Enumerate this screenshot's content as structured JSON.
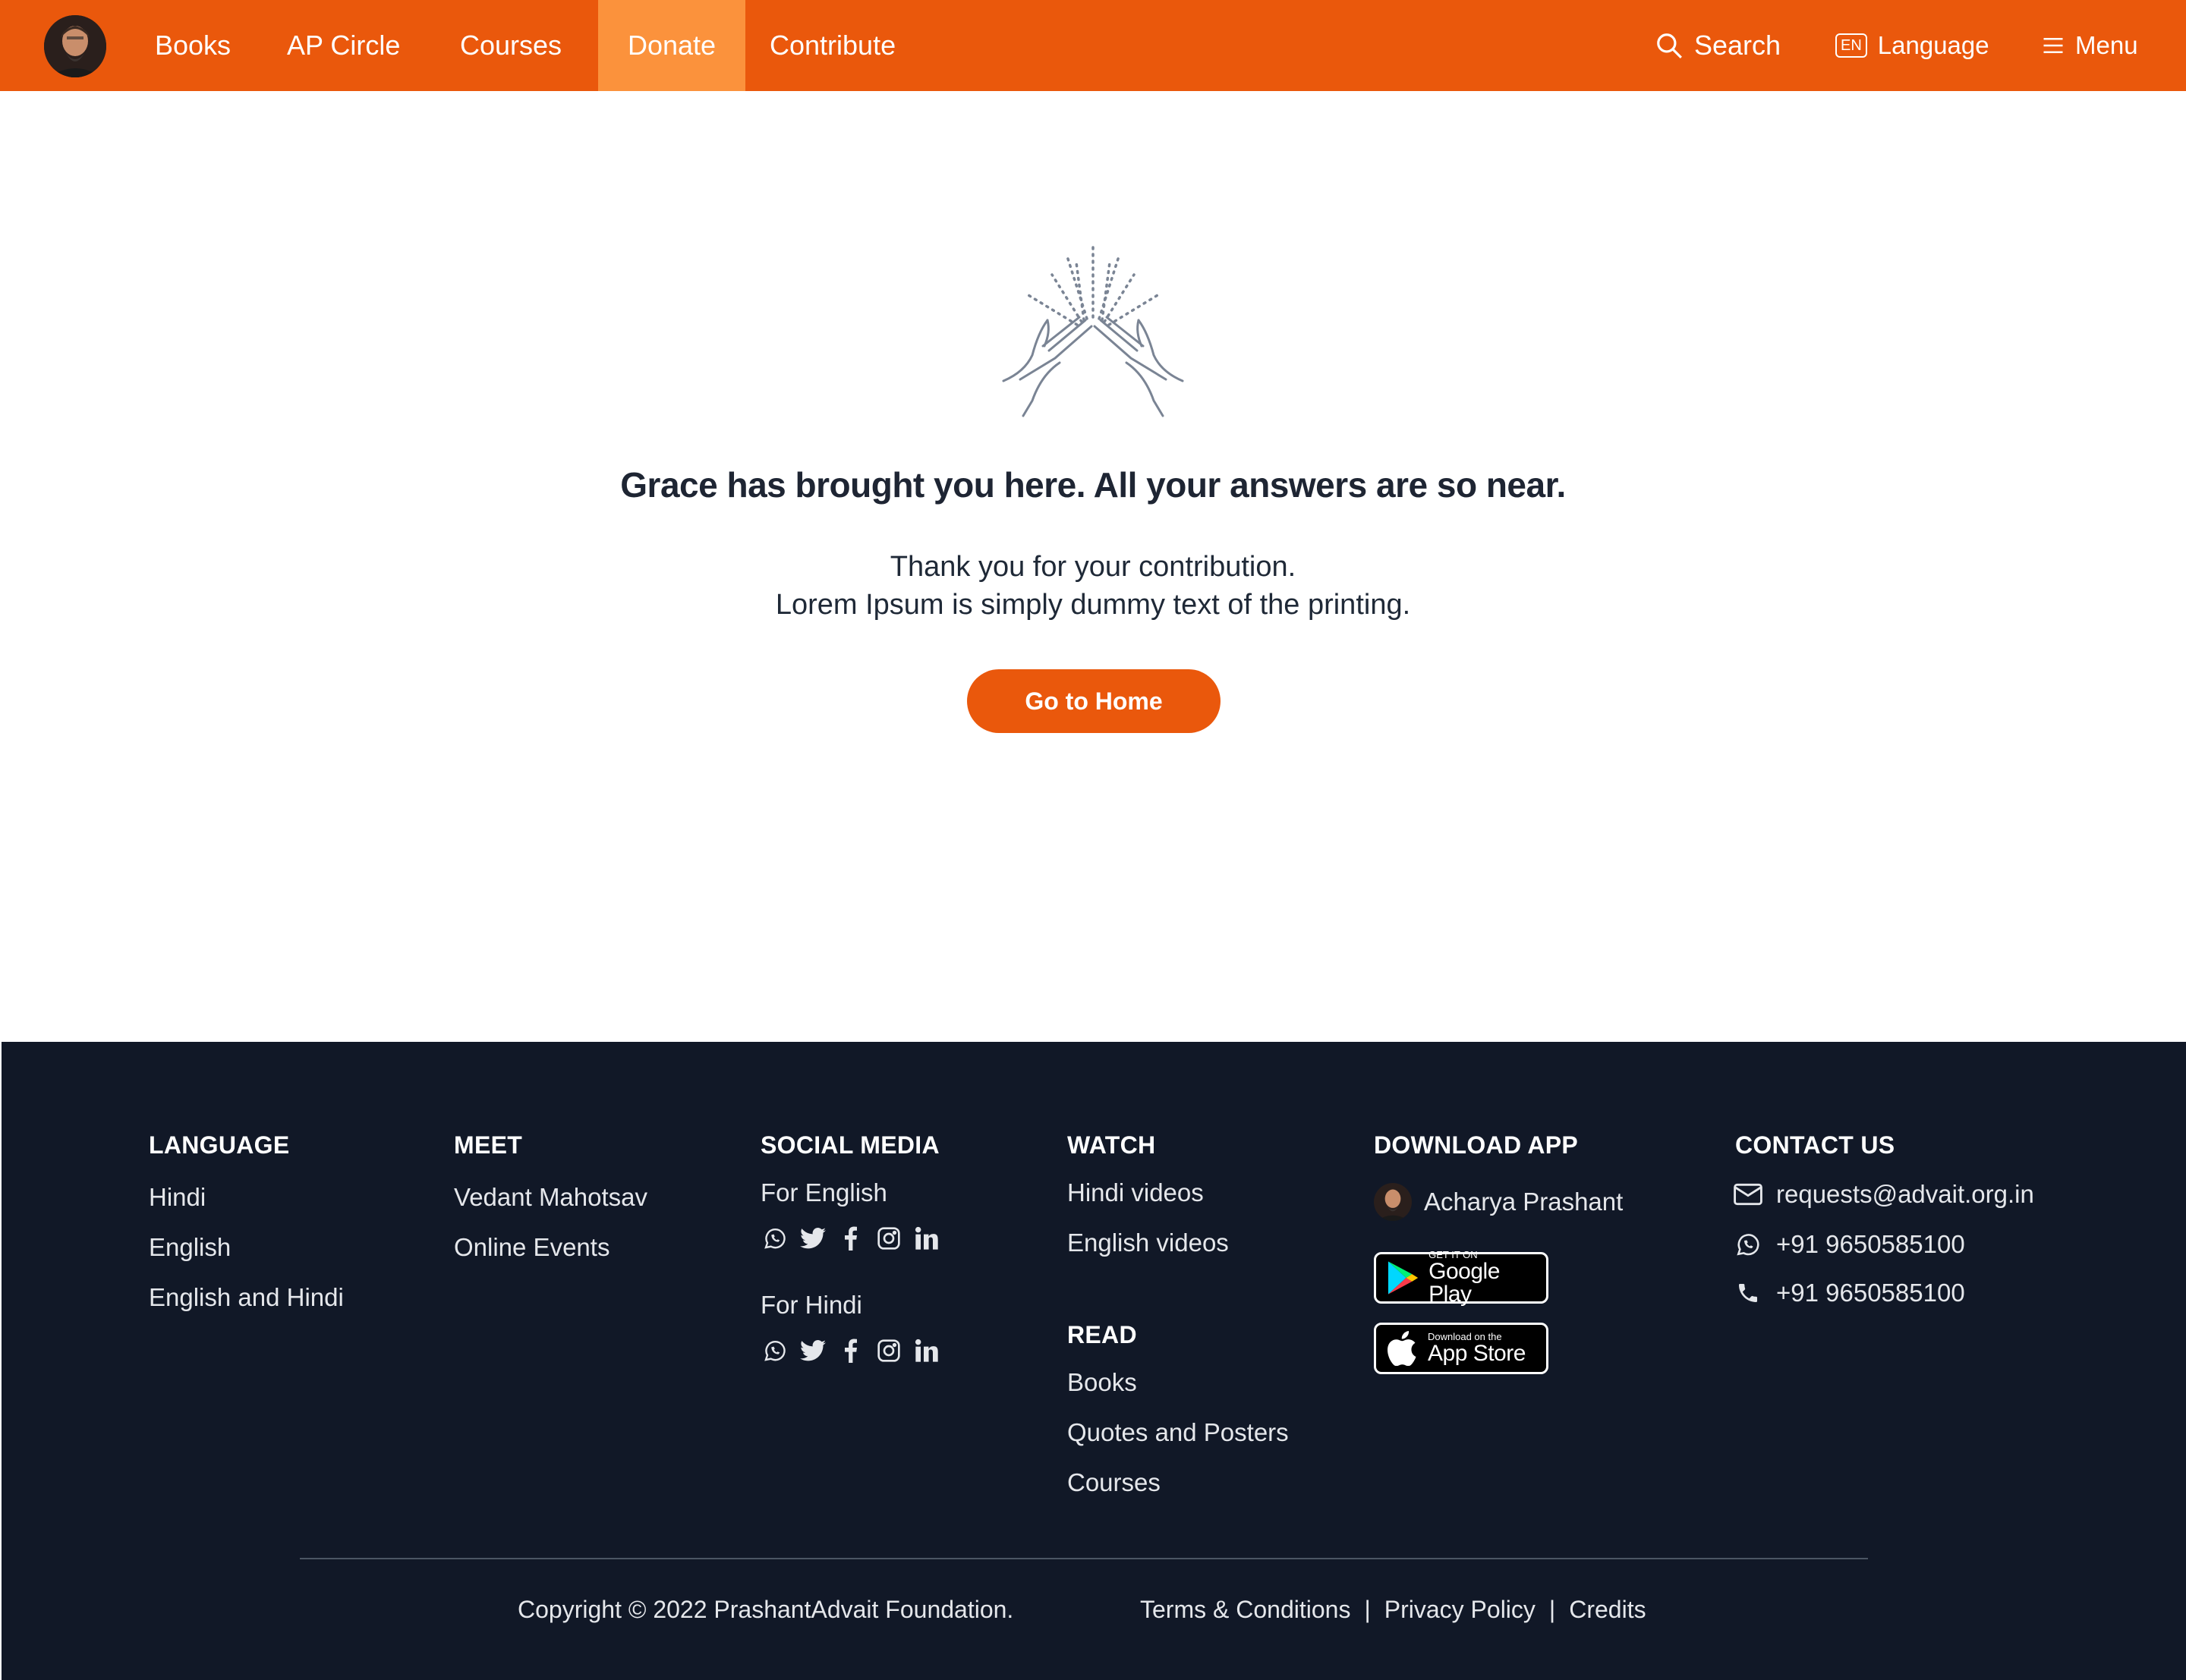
{
  "header": {
    "nav": [
      {
        "label": "Books",
        "active": false
      },
      {
        "label": "AP Circle",
        "active": false
      },
      {
        "label": "Courses",
        "active": false
      },
      {
        "label": "Donate",
        "active": true
      },
      {
        "label": "Contribute",
        "active": false
      }
    ],
    "search_label": "Search",
    "language_badge": "EN",
    "language_label": "Language",
    "menu_label": "Menu"
  },
  "main": {
    "heading": "Grace has brought you here. All your answers are so near.",
    "line1": "Thank you for your contribution.",
    "line2": "Lorem Ipsum is simply dummy text of the printing.",
    "button_label": "Go to Home"
  },
  "footer": {
    "language": {
      "title": "LANGUAGE",
      "items": [
        "Hindi",
        "English",
        "English and Hindi"
      ]
    },
    "meet": {
      "title": "MEET",
      "items": [
        "Vedant Mahotsav",
        "Online Events"
      ]
    },
    "social": {
      "title": "SOCIAL MEDIA",
      "english_label": "For English",
      "hindi_label": "For Hindi",
      "icons": [
        "whatsapp-icon",
        "twitter-icon",
        "facebook-icon",
        "instagram-icon",
        "linkedin-icon"
      ]
    },
    "watch": {
      "title": "WATCH",
      "items": [
        "Hindi videos",
        "English videos"
      ]
    },
    "read": {
      "title": "READ",
      "items": [
        "Books",
        "Quotes and Posters",
        "Courses"
      ]
    },
    "download": {
      "title": "DOWNLOAD APP",
      "app_name": "Acharya Prashant",
      "google_small": "GET IT ON",
      "google_big": "Google Play",
      "apple_small": "Download on the",
      "apple_big": "App Store"
    },
    "contact": {
      "title": "CONTACT US",
      "email": "requests@advait.org.in",
      "whatsapp": "+91 9650585100",
      "phone": "+91 9650585100"
    },
    "copyright": "Copyright © 2022 PrashantAdvait Foundation.",
    "legal": {
      "terms": "Terms & Conditions",
      "privacy": "Privacy Policy",
      "credits": "Credits",
      "separator": "|"
    }
  },
  "colors": {
    "brand": "#ea580c",
    "active_tab": "#fb923c",
    "footer_bg": "#111827",
    "heading": "#1e2533"
  }
}
